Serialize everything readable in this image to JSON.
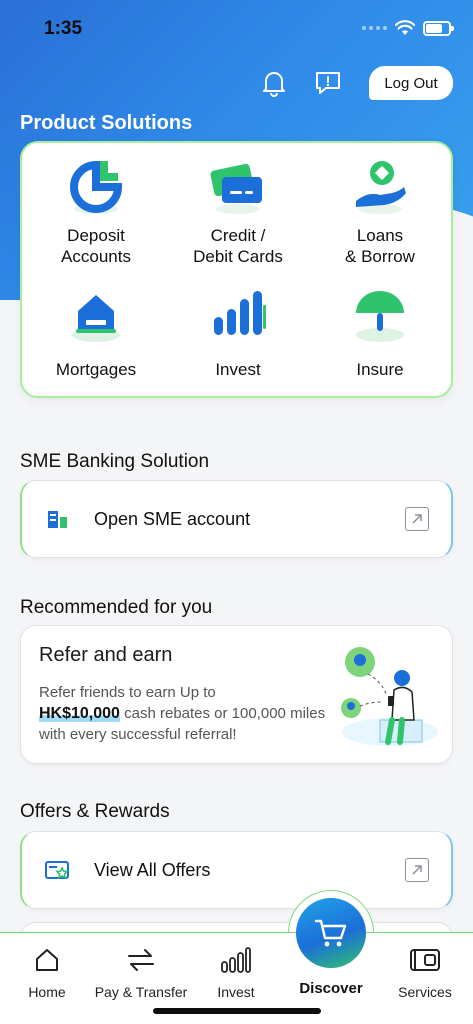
{
  "status_bar": {
    "time": "1:35"
  },
  "header": {
    "logout_label": "Log Out"
  },
  "product_solutions": {
    "title": "Product Solutions",
    "items": [
      {
        "label_line1": "Deposit",
        "label_line2": "Accounts",
        "icon": "deposit-icon"
      },
      {
        "label_line1": "Credit /",
        "label_line2": "Debit Cards",
        "icon": "cards-icon"
      },
      {
        "label_line1": "Loans",
        "label_line2": "& Borrow",
        "icon": "loans-icon"
      },
      {
        "label_line1": "Mortgages",
        "label_line2": "",
        "icon": "house-icon"
      },
      {
        "label_line1": "Invest",
        "label_line2": "",
        "icon": "bar-chart-icon"
      },
      {
        "label_line1": "Insure",
        "label_line2": "",
        "icon": "umbrella-icon"
      }
    ]
  },
  "sme": {
    "title": "SME Banking Solution",
    "action_label": "Open SME account"
  },
  "recommended": {
    "title": "Recommended for you",
    "card_title": "Refer and earn",
    "desc_before": "Refer friends to earn Up to",
    "desc_highlight": "HK$10,000",
    "desc_after": "cash rebates or 100,000 miles with every successful referral!"
  },
  "offers": {
    "title": "Offers & Rewards",
    "action_label": "View All Offers"
  },
  "bottom_nav": {
    "home": "Home",
    "pay": "Pay & Transfer",
    "invest": "Invest",
    "discover": "Discover",
    "services": "Services"
  },
  "colors": {
    "brand_blue": "#2a6fd6",
    "brand_green": "#2fc46b",
    "accent_border": "#a6ef9e"
  }
}
